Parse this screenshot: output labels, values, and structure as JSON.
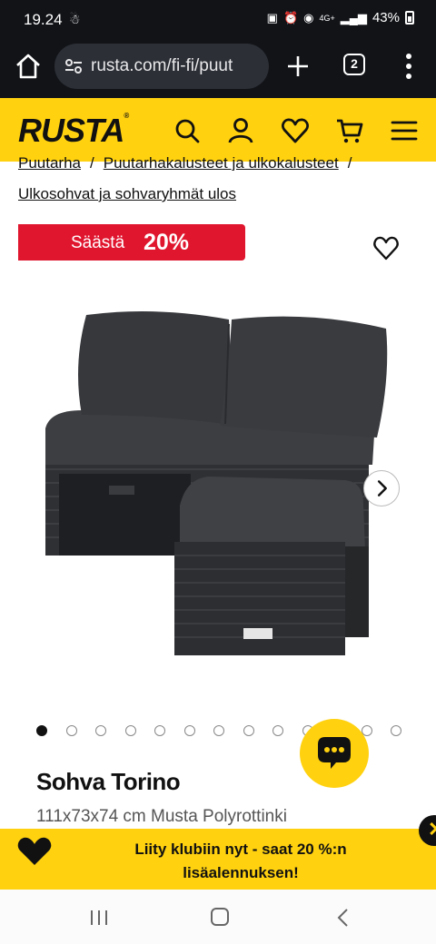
{
  "status_bar": {
    "time": "19.24",
    "network": "4G+",
    "battery": "43%"
  },
  "browser": {
    "url": "rusta.com/fi-fi/puut",
    "tab_count": "2"
  },
  "site": {
    "logo": "RUSTA",
    "logo_mark": "®",
    "colors": {
      "brand_yellow": "#ffd10f",
      "sale_red": "#e0152e"
    },
    "header_icons": [
      "search-icon",
      "account-icon",
      "wishlist-icon",
      "cart-icon",
      "hamburger-menu-icon"
    ]
  },
  "breadcrumbs": {
    "items": [
      "Puutarha",
      "Puutarhakalusteet ja ulkokalusteet",
      "Ulkosohvat ja sohvaryhmät ulos"
    ],
    "separator": "/"
  },
  "product": {
    "save_label": "Säästä",
    "save_percent": "20%",
    "name": "Sohva Torino",
    "description": "111x73x74 cm Musta Polyrottinki",
    "image_alt": "dark grey rattan outdoor sofa with footstool",
    "carousel": {
      "count": 13,
      "active_index": 0
    }
  },
  "promo": {
    "text": "Liity klubiin nyt - saat 20 %:n lisäalennuksen!",
    "close_label": "✕"
  },
  "system_nav": [
    "recents",
    "home",
    "back"
  ]
}
